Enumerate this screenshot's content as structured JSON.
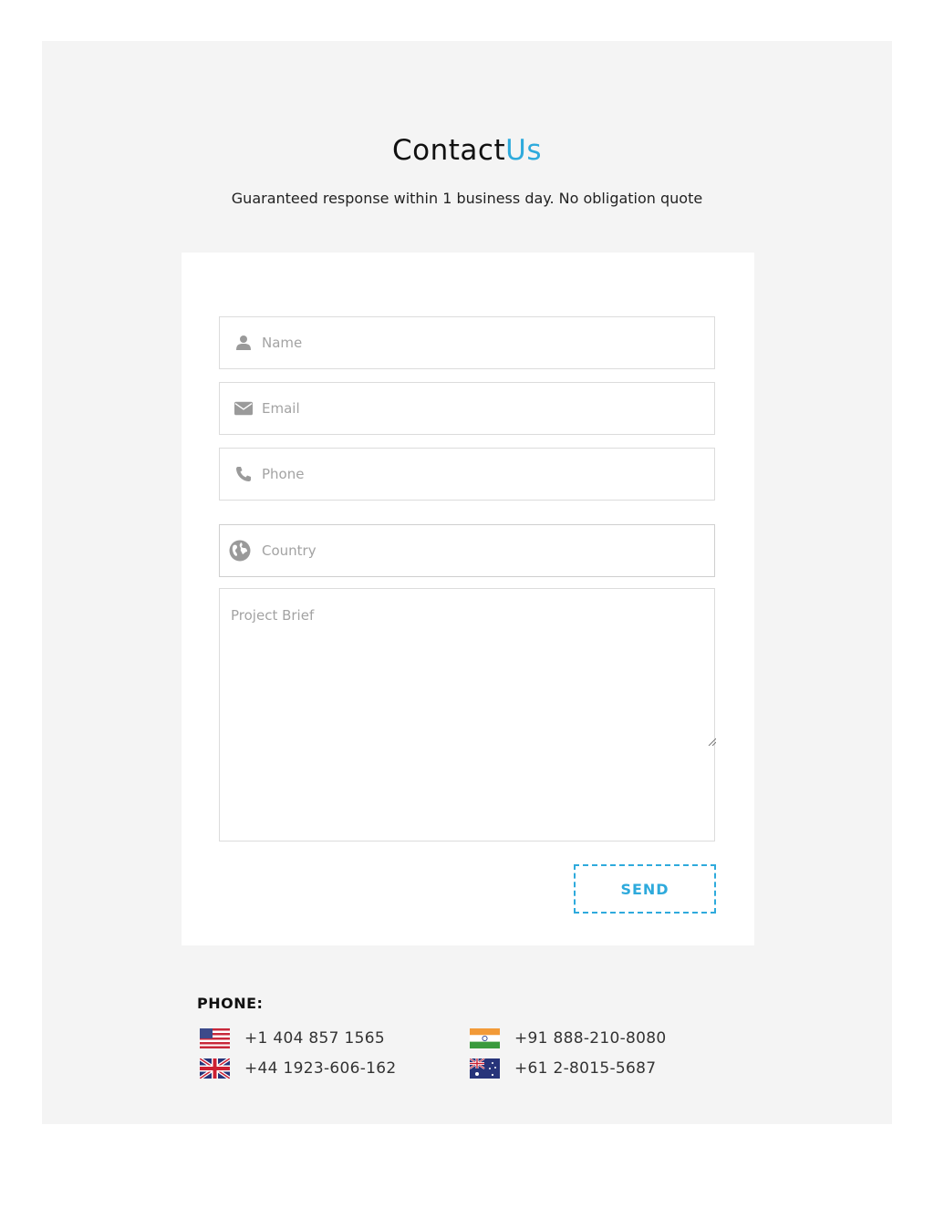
{
  "header": {
    "title_main": "Contact",
    "title_accent": "Us",
    "subtitle": "Guaranteed response within 1 business day. No obligation quote"
  },
  "form": {
    "name_placeholder": "Name",
    "email_placeholder": "Email",
    "phone_placeholder": "Phone",
    "country_placeholder": "Country",
    "brief_placeholder": "Project Brief",
    "send_label": "SEND"
  },
  "phones": {
    "label": "PHONE:",
    "entries": [
      {
        "country": "us-flag-icon",
        "number": "+1 404 857 1565"
      },
      {
        "country": "india-flag-icon",
        "number": "+91 888-210-8080"
      },
      {
        "country": "uk-flag-icon",
        "number": "+44 1923-606-162"
      },
      {
        "country": "australia-flag-icon",
        "number": "+61 2-8015-5687"
      }
    ]
  },
  "colors": {
    "accent": "#2eaadc",
    "section_bg": "#f4f4f4",
    "placeholder": "#a3a3a3",
    "icon": "#9a9a9a"
  }
}
